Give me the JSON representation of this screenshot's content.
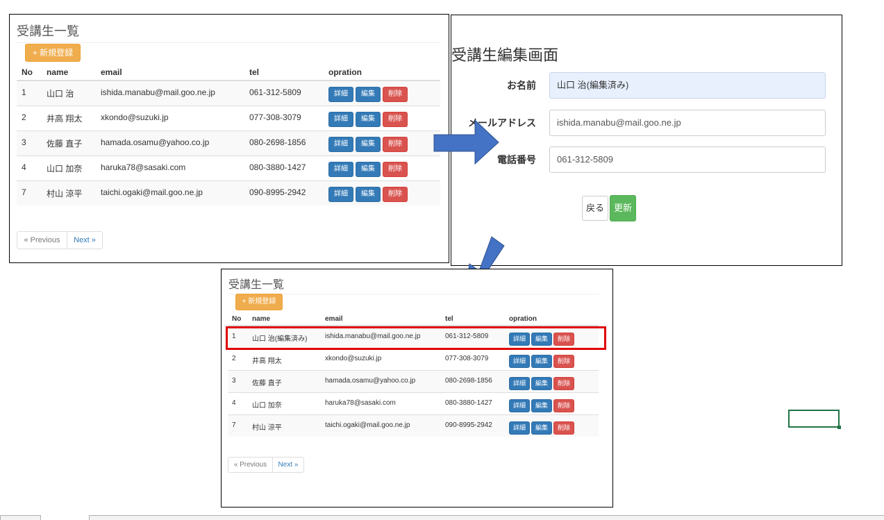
{
  "list_before": {
    "title": "受講生一覧",
    "new_button": "+ 新規登録",
    "columns": [
      "No",
      "name",
      "email",
      "tel",
      "opration"
    ],
    "rows": [
      {
        "no": "1",
        "name": "山口 治",
        "email": "ishida.manabu@mail.goo.ne.jp",
        "tel": "061-312-5809"
      },
      {
        "no": "2",
        "name": "井高 翔太",
        "email": "xkondo@suzuki.jp",
        "tel": "077-308-3079"
      },
      {
        "no": "3",
        "name": "佐藤 直子",
        "email": "hamada.osamu@yahoo.co.jp",
        "tel": "080-2698-1856"
      },
      {
        "no": "4",
        "name": "山口 加奈",
        "email": "haruka78@sasaki.com",
        "tel": "080-3880-1427"
      },
      {
        "no": "7",
        "name": "村山 涼平",
        "email": "taichi.ogaki@mail.goo.ne.jp",
        "tel": "090-8995-2942"
      }
    ],
    "row_buttons": {
      "detail": "詳細",
      "edit": "編集",
      "delete": "削除"
    },
    "pagination": {
      "previous": "« Previous",
      "next": "Next »"
    }
  },
  "edit_screen": {
    "title": "受講生編集画面",
    "fields": {
      "name_label": "お名前",
      "name_value": "山口 治(編集済み)",
      "email_label": "メールアドレス",
      "email_value": "ishida.manabu@mail.goo.ne.jp",
      "tel_label": "電話番号",
      "tel_value": "061-312-5809"
    },
    "back_button": "戻る",
    "update_button": "更新"
  },
  "list_after": {
    "title": "受講生一覧",
    "new_button": "+ 新規登録",
    "columns": [
      "No",
      "name",
      "email",
      "tel",
      "opration"
    ],
    "rows": [
      {
        "no": "1",
        "name": "山口 治(編集済み)",
        "email": "ishida.manabu@mail.goo.ne.jp",
        "tel": "061-312-5809"
      },
      {
        "no": "2",
        "name": "井高 翔太",
        "email": "xkondo@suzuki.jp",
        "tel": "077-308-3079"
      },
      {
        "no": "3",
        "name": "佐藤 直子",
        "email": "hamada.osamu@yahoo.co.jp",
        "tel": "080-2698-1856"
      },
      {
        "no": "4",
        "name": "山口 加奈",
        "email": "haruka78@sasaki.com",
        "tel": "080-3880-1427"
      },
      {
        "no": "7",
        "name": "村山 涼平",
        "email": "taichi.ogaki@mail.goo.ne.jp",
        "tel": "090-8995-2942"
      }
    ],
    "row_buttons": {
      "detail": "詳細",
      "edit": "編集",
      "delete": "削除"
    },
    "pagination": {
      "previous": "« Previous",
      "next": "Next »"
    }
  },
  "colors": {
    "arrow": "#4472c4",
    "highlight": "#e00000",
    "excel_cell": "#217346"
  }
}
